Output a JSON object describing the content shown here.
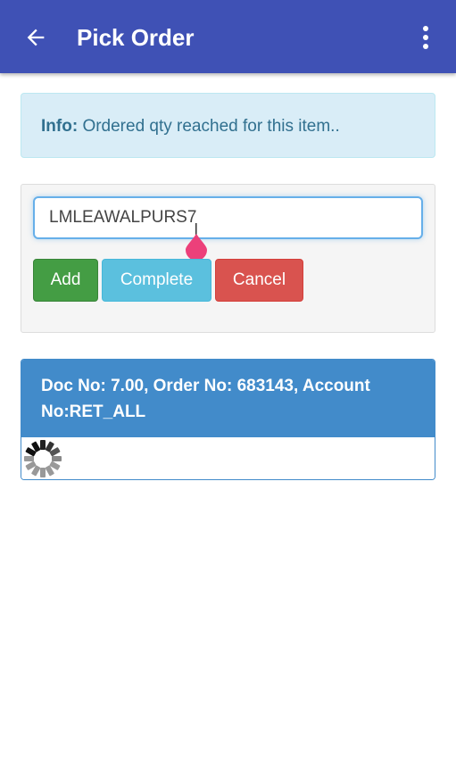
{
  "appbar": {
    "title": "Pick Order",
    "back_icon": "arrow-left-icon",
    "menu_icon": "more-vertical-icon",
    "color": "#3f51b5"
  },
  "info": {
    "label": "Info:",
    "message": "Ordered qty reached for this item.."
  },
  "scan": {
    "value": "LMLEAWALPURS7",
    "add_label": "Add",
    "complete_label": "Complete",
    "cancel_label": "Cancel"
  },
  "doc": {
    "header": "Doc No: 7.00, Order No: 683143, Account No:RET_ALL",
    "loading_icon": "spinner-icon"
  },
  "colors": {
    "info_bg": "#d9edf7",
    "info_text": "#31708f",
    "add": "#449d44",
    "complete": "#5bc0de",
    "cancel": "#d9534f",
    "doc_header": "#428bca",
    "cursor_handle": "#ec407a"
  }
}
